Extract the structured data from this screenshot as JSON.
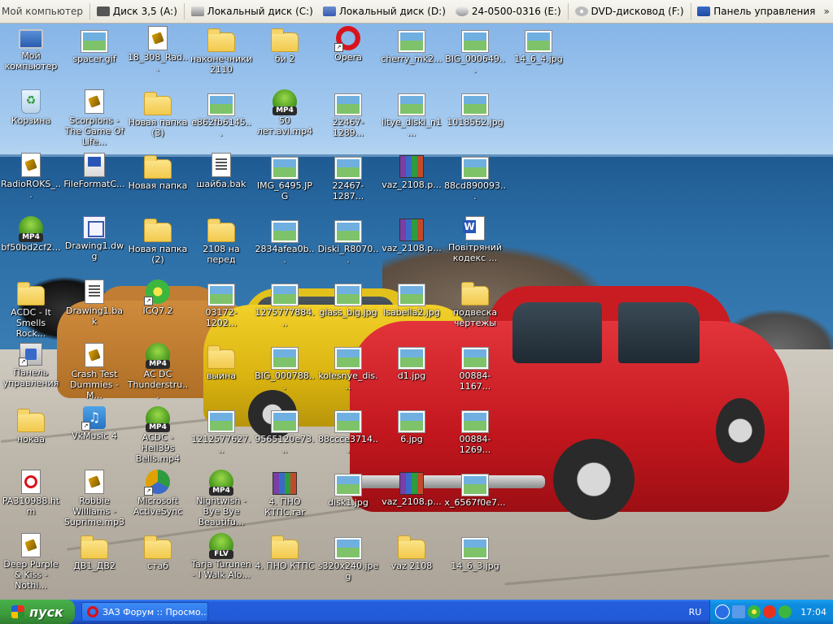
{
  "toolbar": {
    "items": [
      {
        "label": "Мой компьютер",
        "icon": "computer-icon"
      },
      {
        "label": "Диск 3,5 (A:)",
        "icon": "floppy-icon"
      },
      {
        "label": "Локальный диск (C:)",
        "icon": "drive-icon"
      },
      {
        "label": "Локальный диск (D:)",
        "icon": "drive-icon"
      },
      {
        "label": "24-0500-0316 (E:)",
        "icon": "drive-icon"
      },
      {
        "label": "DVD-дисковод (F:)",
        "icon": "dvd-icon"
      },
      {
        "label": "Панель управления",
        "icon": "control-panel-icon"
      }
    ],
    "overflow": "»"
  },
  "icons": [
    {
      "label": "Мой компьютер",
      "type": "pc"
    },
    {
      "label": "spacer.gif",
      "type": "image"
    },
    {
      "label": "18_308_Rad...",
      "type": "doc"
    },
    {
      "label": "наконечники 2110",
      "type": "folder"
    },
    {
      "label": "би 2",
      "type": "folder"
    },
    {
      "label": "Opera",
      "type": "opera",
      "shortcut": true
    },
    {
      "label": "cherry_mk2...",
      "type": "image"
    },
    {
      "label": "BIG_000649...",
      "type": "image"
    },
    {
      "label": "14_6_4.jpg",
      "type": "image"
    },
    {
      "label": "Корзина",
      "type": "bin"
    },
    {
      "label": "Scorpions - The Game Of Life...",
      "type": "doc"
    },
    {
      "label": "Новая папка (3)",
      "type": "folder"
    },
    {
      "label": "e862fb6145...",
      "type": "image"
    },
    {
      "label": "50 лет.avi.mp4",
      "type": "mp4"
    },
    {
      "label": "22467-1289...",
      "type": "image"
    },
    {
      "label": "litye_diski_n1...",
      "type": "image"
    },
    {
      "label": "1018562.jpg",
      "type": "image"
    },
    {
      "label": "RadioROKS_...",
      "type": "doc"
    },
    {
      "label": "FileFormatC...",
      "type": "fmt"
    },
    {
      "label": "Новая папка",
      "type": "folder"
    },
    {
      "label": "шайба.bak",
      "type": "bak"
    },
    {
      "label": "IMG_6495.JPG",
      "type": "image"
    },
    {
      "label": "22467-1287...",
      "type": "image"
    },
    {
      "label": "vaz_2108.p...",
      "type": "rar"
    },
    {
      "label": "88cd890093...",
      "type": "image"
    },
    {
      "label": "bf50bd2cf2...",
      "type": "mp4"
    },
    {
      "label": "Drawing1.dwg",
      "type": "dwg"
    },
    {
      "label": "Новая папка (2)",
      "type": "folder"
    },
    {
      "label": "2108 на перед",
      "type": "folder"
    },
    {
      "label": "2834afea0b...",
      "type": "image"
    },
    {
      "label": "Diski_R8070...",
      "type": "image"
    },
    {
      "label": "vaz_2108.p...",
      "type": "rar"
    },
    {
      "label": "Повітряний кодекс ...",
      "type": "word"
    },
    {
      "label": "ACDC - It Smells Rock...",
      "type": "folder"
    },
    {
      "label": "Drawing1.bak",
      "type": "bak"
    },
    {
      "label": "ICQ7.2",
      "type": "icq",
      "shortcut": true
    },
    {
      "label": "03172-1202...",
      "type": "image"
    },
    {
      "label": "1275777884...",
      "type": "image"
    },
    {
      "label": "glass_big.jpg",
      "type": "image"
    },
    {
      "label": "isabella2.jpg",
      "type": "image"
    },
    {
      "label": "подвеска чертежы",
      "type": "folder"
    },
    {
      "label": "Панель управления",
      "type": "cpanel",
      "shortcut": true
    },
    {
      "label": "Crash Test Dummies - M...",
      "type": "doc"
    },
    {
      "label": "AC DC Thunderstru...",
      "type": "mp4"
    },
    {
      "label": "выина",
      "type": "folder"
    },
    {
      "label": "BIG_000788...",
      "type": "image"
    },
    {
      "label": "kolesnye_dis...",
      "type": "image"
    },
    {
      "label": "d1.jpg",
      "type": "image"
    },
    {
      "label": "00884-1167...",
      "type": "image"
    },
    {
      "label": "нокаа",
      "type": "folder"
    },
    {
      "label": "VkMusic 4",
      "type": "vk",
      "shortcut": true
    },
    {
      "label": "ACDC - Hell39s Bells.mp4",
      "type": "mp4"
    },
    {
      "label": "1212577627...",
      "type": "image"
    },
    {
      "label": "9565120e73...",
      "type": "image"
    },
    {
      "label": "88ccce3714...",
      "type": "image"
    },
    {
      "label": "6.jpg",
      "type": "image"
    },
    {
      "label": "00884-1269...",
      "type": "image"
    },
    {
      "label": "PA310988.htm",
      "type": "pdf"
    },
    {
      "label": "Robbie Williams - Suprime.mp3",
      "type": "doc"
    },
    {
      "label": "Microsoft ActiveSync",
      "type": "sync",
      "shortcut": true
    },
    {
      "label": "Nightwish - Bye Bye Beautifu...",
      "type": "mp4"
    },
    {
      "label": "4. ПНО КТПС.rar",
      "type": "rar"
    },
    {
      "label": "disk1.jpg",
      "type": "image"
    },
    {
      "label": "vaz_2108.p...",
      "type": "rar"
    },
    {
      "label": "x_6567f0e7...",
      "type": "image"
    },
    {
      "label": "Deep Purple & Kiss - Nothi...",
      "type": "doc"
    },
    {
      "label": "ДВ1_ДВ2",
      "type": "folder"
    },
    {
      "label": "стаб",
      "type": "folder"
    },
    {
      "label": "Tarja Turunen - I Walk Alo...",
      "type": "flv"
    },
    {
      "label": "4. ПНО КТПС",
      "type": "folder"
    },
    {
      "label": "s320x240.jpeg",
      "type": "image"
    },
    {
      "label": "vaz 2108",
      "type": "folder"
    },
    {
      "label": "14_6_3.jpg",
      "type": "image"
    }
  ],
  "taskbar": {
    "start_label": "пуск",
    "tasks": [
      {
        "label": "ЗАЗ Форум :: Просмо..."
      }
    ],
    "language": "RU",
    "clock": "17:04"
  }
}
